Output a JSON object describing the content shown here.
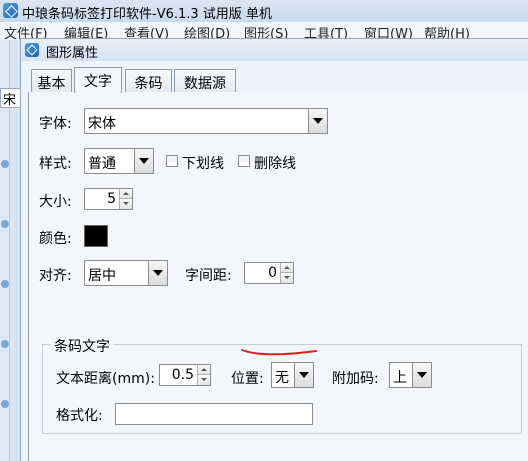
{
  "app": {
    "title": "中琅条码标签打印软件-V6.1.3 试用版 单机",
    "menu": [
      "文件(F)",
      "编辑(E)",
      "查看(V)",
      "绘图(D)",
      "图形(S)",
      "工具(T)",
      "窗口(W)",
      "帮助(H)"
    ],
    "side_label": "宋"
  },
  "dialog": {
    "title": "图形属性",
    "tabs": [
      "基本",
      "文字",
      "条码",
      "数据源"
    ],
    "active_tab": "文字"
  },
  "text_tab": {
    "font_label": "字体:",
    "font_value": "宋体",
    "style_label": "样式:",
    "style_value": "普通",
    "underline_label": "下划线",
    "strikethrough_label": "删除线",
    "size_label": "大小:",
    "size_value": "5",
    "color_label": "颜色:",
    "color_value": "#000000",
    "align_label": "对齐:",
    "align_value": "居中",
    "spacing_label": "字间距:",
    "spacing_value": "0"
  },
  "barcode_text": {
    "group_title": "条码文字",
    "distance_label": "文本距离(mm):",
    "distance_value": "0.5",
    "position_label": "位置:",
    "position_value": "无",
    "addon_label": "附加码:",
    "addon_value": "上",
    "format_label": "格式化:",
    "format_value": ""
  },
  "annotation_color": "#e02020"
}
